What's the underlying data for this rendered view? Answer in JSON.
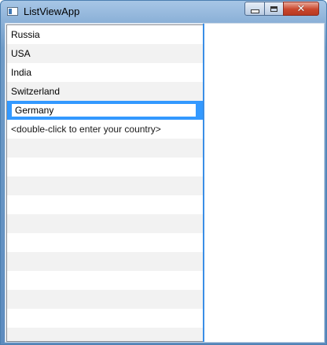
{
  "window": {
    "title": "ListViewApp",
    "icon": "app-window-icon",
    "controls": {
      "minimize": "minimize-icon",
      "maximize": "maximize-icon",
      "close": "✕"
    }
  },
  "list": {
    "rows": [
      {
        "label": "Russia"
      },
      {
        "label": "USA"
      },
      {
        "label": "India"
      },
      {
        "label": "Switzerland"
      }
    ],
    "editing_value": "Germany",
    "hint": "<double-click to enter your country>"
  },
  "colors": {
    "accent": "#3399ff",
    "alt_row": "#f2f2f2"
  }
}
